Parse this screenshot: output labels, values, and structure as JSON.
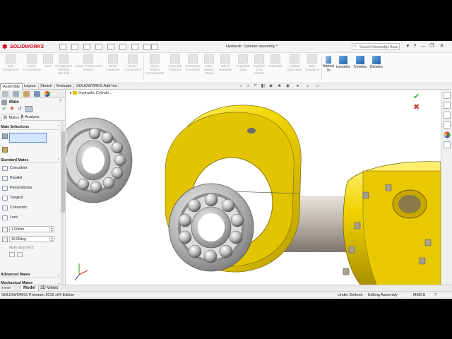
{
  "app": {
    "brand": "SOLIDWORKS",
    "document_title": "Hydraulic Cylinder assembly *",
    "search_placeholder": "Search Knowledge Base",
    "minimize": "–",
    "restore": "❐",
    "close": "✕",
    "help": "?"
  },
  "command_manager": {
    "disabled_commands": [
      "Edit\nComponent",
      "Insert\nComponents",
      "Mate",
      "Component\nPreview\nWindow",
      "Linear Component\nPattern",
      "Smart\nFasteners",
      "Move\nComponent",
      "Show\nHidden\nComponents",
      "Assembly\nFeatures",
      "Reference\nGeometry",
      "New\nMotion\nStudy",
      "Bill of\nMaterials",
      "Exploded\nView",
      "Explode\nLine\nSketch",
      "Instant3D",
      "Update\nSpeedpak",
      "Take\nSnapshot"
    ],
    "view_commands": [
      "Normal\nTo",
      "Isometric",
      "Trimetric",
      "Dimetric"
    ]
  },
  "tabs": [
    "Assembly",
    "Layout",
    "Sketch",
    "Evaluate",
    "SOLIDWORKS Add-Ins"
  ],
  "active_tab": "Assembly",
  "property_manager": {
    "title": "Mate",
    "help_icon": "?",
    "subtabs": [
      "Mates",
      "Analysis"
    ],
    "sections": {
      "selections": "Mate Selections",
      "standard": "Standard Mates",
      "advanced": "Advanced Mates",
      "mechanical": "Mechanical Mates"
    },
    "standard_mates": [
      "Coincident",
      "Parallel",
      "Perpendicular",
      "Tangent",
      "Concentric",
      "Lock"
    ],
    "distance_value": "1.00mm",
    "angle_value": "30.00deg",
    "mate_alignment": "Mate alignment:"
  },
  "viewport": {
    "flyout_tree_item": "Hydraulic Cylinde..."
  },
  "bottom_tabs": [
    "Model",
    "3D Views"
  ],
  "active_bottom_tab": "Model",
  "status": {
    "edition": "SOLIDWORKS Premium 2016 x64 Edition",
    "definition": "Under Defined",
    "mode": "Editing Assembly",
    "units": "MMGS",
    "help": "?"
  },
  "colors": {
    "brand_red": "#d6001c",
    "yellow_part": "#f2d400",
    "selection_blue": "#5a93d6",
    "confirm_green": "#3aa43a",
    "cancel_red": "#d23b3b"
  }
}
